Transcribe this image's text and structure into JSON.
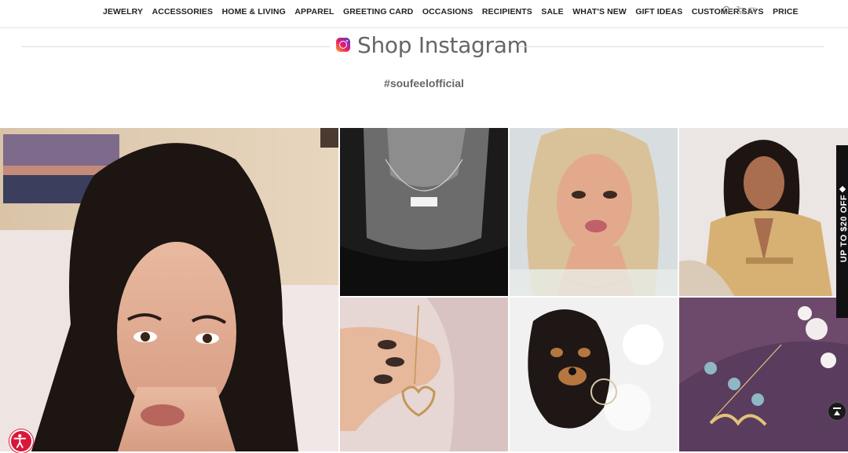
{
  "nav": {
    "items": [
      "JEWELRY",
      "ACCESSORIES",
      "HOME & LIVING",
      "APPAREL",
      "GREETING CARD",
      "OCCASIONS",
      "RECIPIENTS",
      "SALE",
      "WHAT'S NEW",
      "GIFT IDEAS",
      "CUSTOMER SAYS",
      "PRICE"
    ],
    "search_icon": "search-icon",
    "cart_icon": "cart-icon",
    "cart_count": "(0)"
  },
  "section": {
    "title": "Shop Instagram",
    "icon": "instagram-icon",
    "hashtag": "#soufeelofficial"
  },
  "promo": {
    "side_label": "UP TO $20 OFF"
  },
  "colors": {
    "accessibility": "#d8173a",
    "promo_bg": "#111111",
    "title_gray": "#666666"
  }
}
